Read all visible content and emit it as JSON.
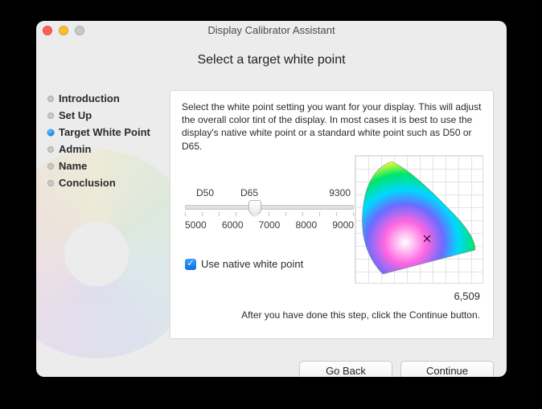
{
  "window_title": "Display Calibrator Assistant",
  "heading": "Select a target white point",
  "sidebar": {
    "steps": [
      {
        "label": "Introduction"
      },
      {
        "label": "Set Up"
      },
      {
        "label": "Target White Point"
      },
      {
        "label": "Admin"
      },
      {
        "label": "Name"
      },
      {
        "label": "Conclusion"
      }
    ],
    "current_index": 2
  },
  "panel": {
    "description": "Select the white point setting you want for your display.  This will adjust the overall color tint of the display.  In most cases it is best to use the display's native white point or a standard white point such as D50 or D65.",
    "slider": {
      "top_labels": [
        "D50",
        "D65",
        "9300"
      ],
      "bottom_labels": [
        "5000",
        "6000",
        "7000",
        "8000",
        "9000"
      ],
      "value_kelvin": 6509,
      "value_display": "6,509",
      "min": 4500,
      "max": 9500
    },
    "checkbox": {
      "label": "Use native white point",
      "checked": true
    },
    "after_note": "After you have done this step, click the Continue button."
  },
  "buttons": {
    "go_back": "Go Back",
    "continue": "Continue"
  },
  "colors": {
    "accent": "#0a6fe4"
  }
}
